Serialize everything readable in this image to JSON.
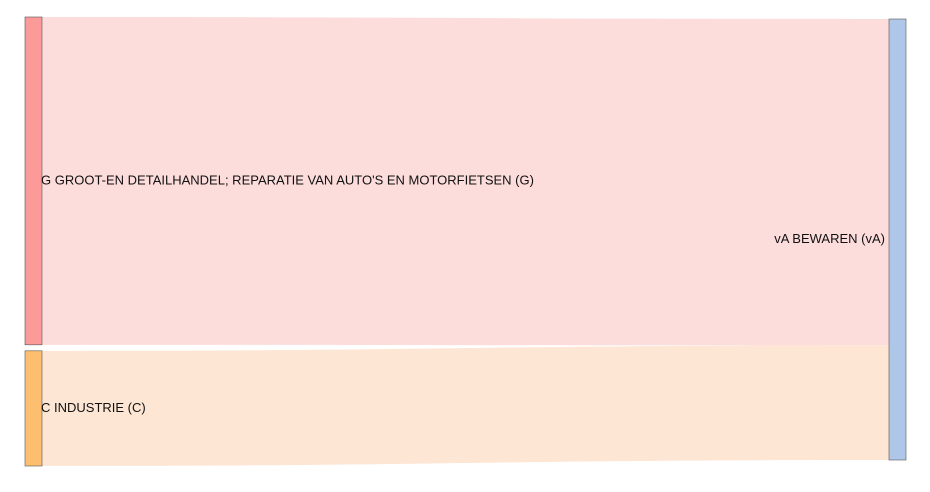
{
  "chart_data": {
    "type": "sankey",
    "title": "",
    "nodes": [
      {
        "id": "G",
        "label": "G GROOT-EN DETAILHANDEL; REPARATIE VAN AUTO'S EN MOTORFIETSEN (G)",
        "side": "left",
        "color": "#fb9a99",
        "link_color": "#fddcdc"
      },
      {
        "id": "C",
        "label": "C INDUSTRIE (C)",
        "side": "left",
        "color": "#fdbf6f",
        "link_color": "#fde6d4"
      },
      {
        "id": "vA",
        "label": "vA BEWAREN (vA)",
        "side": "right",
        "color": "#aec7e8"
      }
    ],
    "links": [
      {
        "source": "G",
        "target": "vA",
        "value": 74
      },
      {
        "source": "C",
        "target": "vA",
        "value": 26
      }
    ]
  }
}
